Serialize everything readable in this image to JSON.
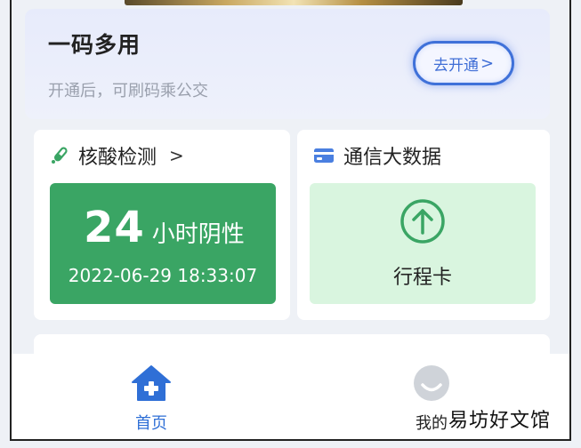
{
  "banner": {
    "title": "一码多用",
    "subtitle": "开通后，可刷码乘公交",
    "button_label": "去开通",
    "button_chevron": ">"
  },
  "nucleic_card": {
    "title": "核酸检测",
    "chevron": ">",
    "icon": "test-tube-icon",
    "hours_value": "24",
    "hours_label": "小时阴性",
    "timestamp": "2022-06-29 18:33:07"
  },
  "telecom_card": {
    "title": "通信大数据",
    "icon": "card-icon",
    "trip_icon": "up-arrow-circle-icon",
    "trip_label": "行程卡"
  },
  "tabbar": {
    "home_label": "首页",
    "mine_label": "我的"
  },
  "watermark": "易坊好文馆",
  "colors": {
    "accent_blue": "#3f6ed6",
    "test_green": "#3aa564",
    "trip_bg": "#d9f5df"
  }
}
